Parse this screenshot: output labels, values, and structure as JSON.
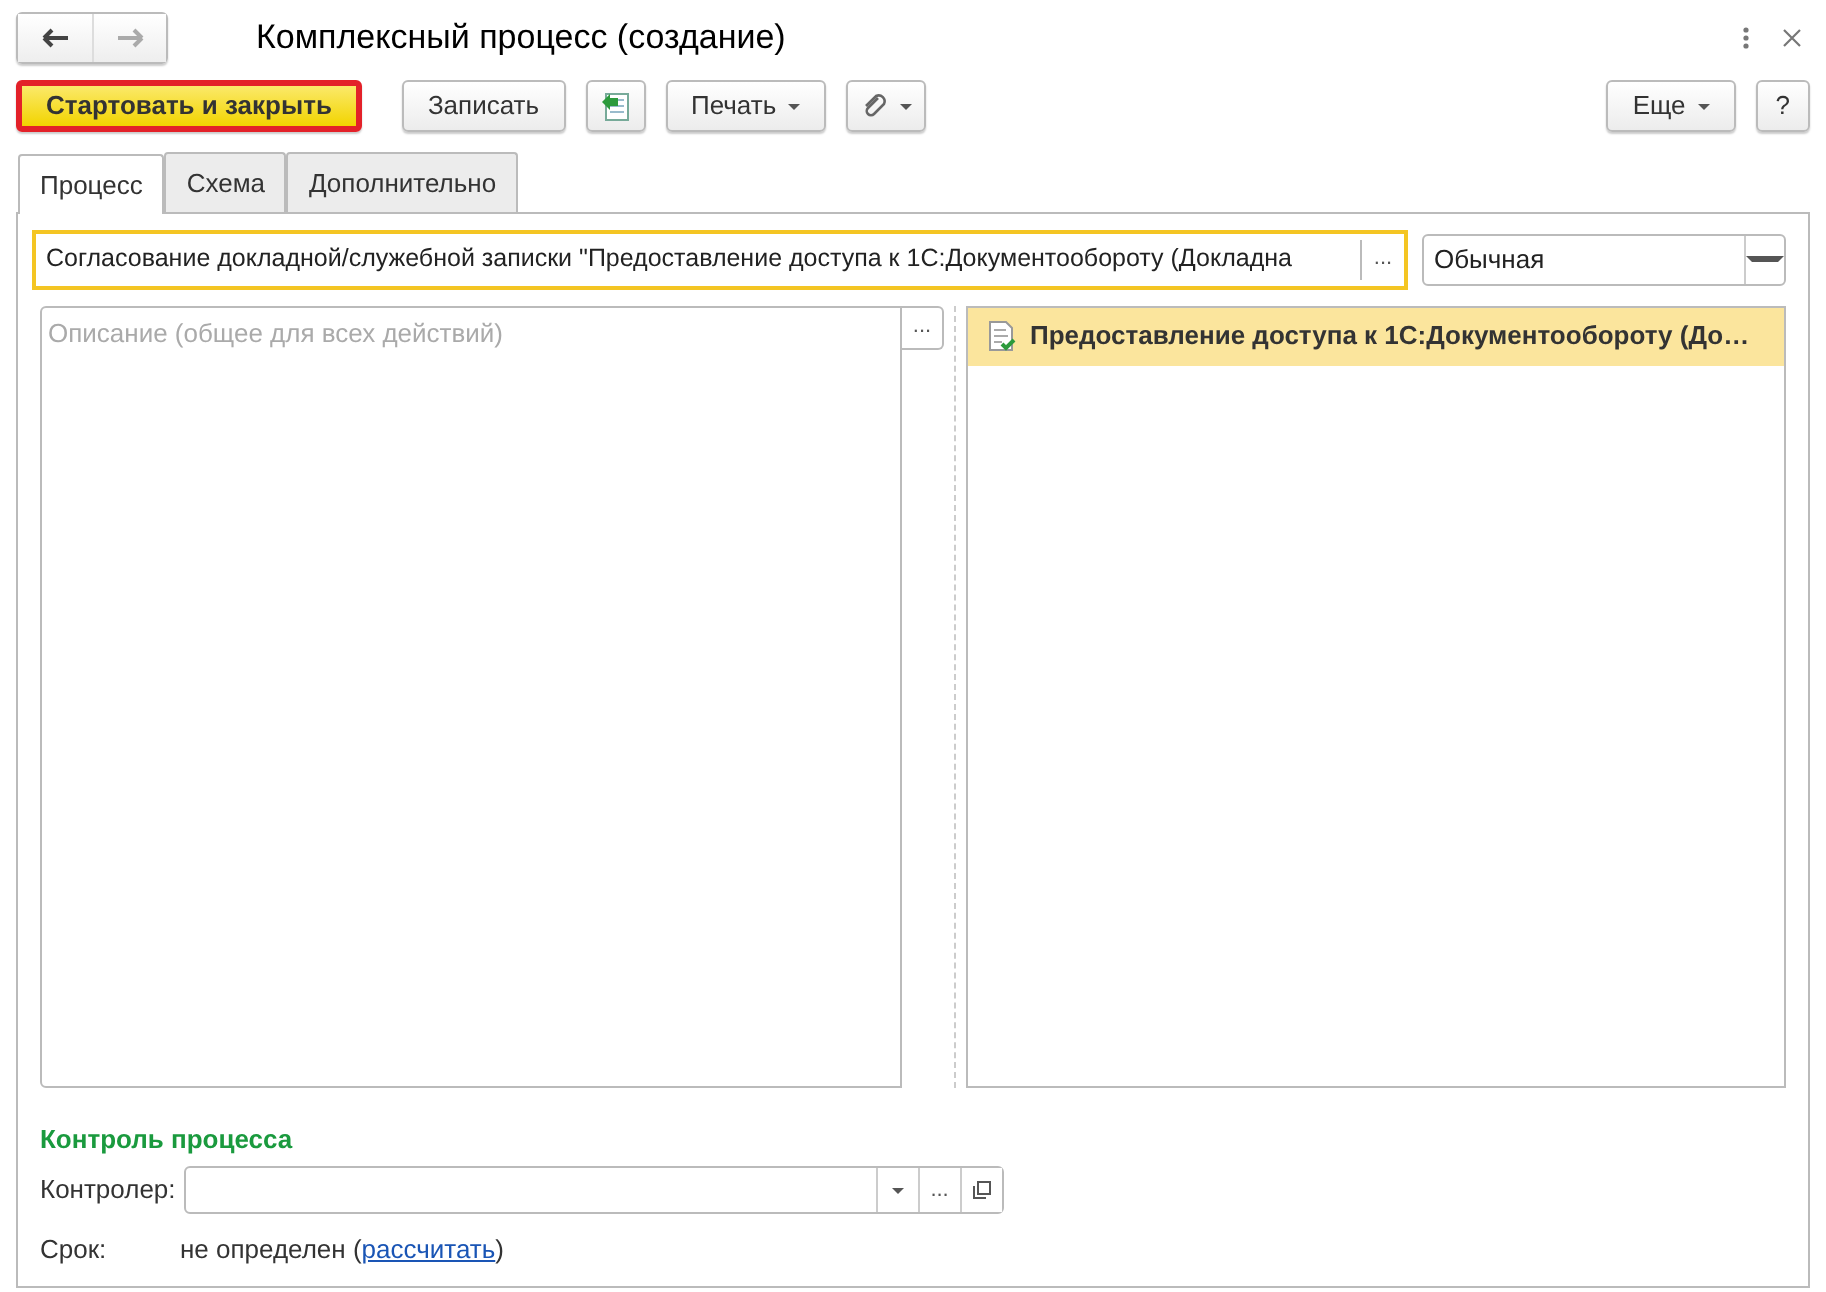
{
  "window": {
    "title": "Комплексный процесс (создание)",
    "nav": [
      {
        "kind": "back",
        "disabled": false
      },
      {
        "kind": "forward",
        "disabled": true
      }
    ]
  },
  "toolbar": {
    "left": [
      {
        "kind": "primary",
        "label": "Стартовать и закрыть"
      },
      {
        "kind": "text",
        "label": "Записать"
      },
      {
        "kind": "icon"
      },
      {
        "kind": "menu",
        "label": "Печать"
      },
      {
        "kind": "icon-menu"
      }
    ],
    "right": [
      {
        "kind": "menu",
        "label": "Еще"
      },
      {
        "kind": "text",
        "label": "?"
      }
    ]
  },
  "tabs": [
    {
      "label": "Процесс",
      "selected": true
    },
    {
      "label": "Схема",
      "selected": false
    },
    {
      "label": "Дополнительно",
      "selected": false
    }
  ],
  "subject": {
    "value": "Согласование докладной/служебной записки \"Предоставление доступа к 1С:Документообороту (Докладна",
    "button": "..."
  },
  "importance": {
    "value": "Обычная"
  },
  "description": {
    "placeholder": "Описание (общее для всех действий)",
    "button": "..."
  },
  "actions": [
    {
      "text": "Предоставление доступа к 1С:Документообороту (До…",
      "selected": true
    }
  ],
  "control": {
    "heading": "Контроль процесса",
    "controller": {
      "label": "Контролер:",
      "button": "..."
    },
    "deadline": {
      "label": "Срок:",
      "value": "не определен (",
      "link": "рассчитать",
      "value_end": ")"
    }
  }
}
